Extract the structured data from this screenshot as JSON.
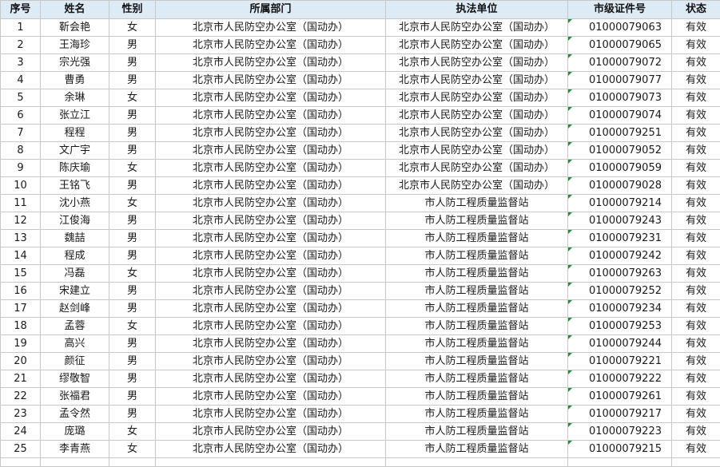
{
  "headers": [
    "序号",
    "姓名",
    "性别",
    "所属部门",
    "执法单位",
    "市级证件号",
    "状态"
  ],
  "rows": [
    [
      "1",
      "靳会艳",
      "女",
      "北京市人民防空办公室（国动办）",
      "北京市人民防空办公室（国动办）",
      "01000079063",
      "有效"
    ],
    [
      "2",
      "王海珍",
      "男",
      "北京市人民防空办公室（国动办）",
      "北京市人民防空办公室（国动办）",
      "01000079065",
      "有效"
    ],
    [
      "3",
      "宗光强",
      "男",
      "北京市人民防空办公室（国动办）",
      "北京市人民防空办公室（国动办）",
      "01000079072",
      "有效"
    ],
    [
      "4",
      "曹勇",
      "男",
      "北京市人民防空办公室（国动办）",
      "北京市人民防空办公室（国动办）",
      "01000079077",
      "有效"
    ],
    [
      "5",
      "余琳",
      "女",
      "北京市人民防空办公室（国动办）",
      "北京市人民防空办公室（国动办）",
      "01000079073",
      "有效"
    ],
    [
      "6",
      "张立江",
      "男",
      "北京市人民防空办公室（国动办）",
      "北京市人民防空办公室（国动办）",
      "01000079074",
      "有效"
    ],
    [
      "7",
      "程程",
      "男",
      "北京市人民防空办公室（国动办）",
      "北京市人民防空办公室（国动办）",
      "01000079251",
      "有效"
    ],
    [
      "8",
      "文广宇",
      "男",
      "北京市人民防空办公室（国动办）",
      "北京市人民防空办公室（国动办）",
      "01000079052",
      "有效"
    ],
    [
      "9",
      "陈庆瑜",
      "女",
      "北京市人民防空办公室（国动办）",
      "北京市人民防空办公室（国动办）",
      "01000079059",
      "有效"
    ],
    [
      "10",
      "王铭飞",
      "男",
      "北京市人民防空办公室（国动办）",
      "北京市人民防空办公室（国动办）",
      "01000079028",
      "有效"
    ],
    [
      "11",
      "沈小燕",
      "女",
      "北京市人民防空办公室（国动办）",
      "市人防工程质量监督站",
      "01000079214",
      "有效"
    ],
    [
      "12",
      "江俊海",
      "男",
      "北京市人民防空办公室（国动办）",
      "市人防工程质量监督站",
      "01000079243",
      "有效"
    ],
    [
      "13",
      "魏喆",
      "男",
      "北京市人民防空办公室（国动办）",
      "市人防工程质量监督站",
      "01000079231",
      "有效"
    ],
    [
      "14",
      "程成",
      "男",
      "北京市人民防空办公室（国动办）",
      "市人防工程质量监督站",
      "01000079242",
      "有效"
    ],
    [
      "15",
      "冯磊",
      "女",
      "北京市人民防空办公室（国动办）",
      "市人防工程质量监督站",
      "01000079263",
      "有效"
    ],
    [
      "16",
      "宋建立",
      "男",
      "北京市人民防空办公室（国动办）",
      "市人防工程质量监督站",
      "01000079252",
      "有效"
    ],
    [
      "17",
      "赵剑峰",
      "男",
      "北京市人民防空办公室（国动办）",
      "市人防工程质量监督站",
      "01000079234",
      "有效"
    ],
    [
      "18",
      "孟蓉",
      "女",
      "北京市人民防空办公室（国动办）",
      "市人防工程质量监督站",
      "01000079253",
      "有效"
    ],
    [
      "19",
      "高兴",
      "男",
      "北京市人民防空办公室（国动办）",
      "市人防工程质量监督站",
      "01000079244",
      "有效"
    ],
    [
      "20",
      "颜征",
      "男",
      "北京市人民防空办公室（国动办）",
      "市人防工程质量监督站",
      "01000079221",
      "有效"
    ],
    [
      "21",
      "缪敬智",
      "男",
      "北京市人民防空办公室（国动办）",
      "市人防工程质量监督站",
      "01000079222",
      "有效"
    ],
    [
      "22",
      "张福君",
      "男",
      "北京市人民防空办公室（国动办）",
      "市人防工程质量监督站",
      "01000079261",
      "有效"
    ],
    [
      "23",
      "孟令然",
      "男",
      "北京市人民防空办公室（国动办）",
      "市人防工程质量监督站",
      "01000079217",
      "有效"
    ],
    [
      "24",
      "庞璐",
      "女",
      "北京市人民防空办公室（国动办）",
      "市人防工程质量监督站",
      "01000079223",
      "有效"
    ],
    [
      "25",
      "李青燕",
      "女",
      "北京市人民防空办公室（国动办）",
      "市人防工程质量监督站",
      "01000079215",
      "有效"
    ]
  ],
  "colors": {
    "header_bg": "#ddebf7",
    "grid": "#c8c8c8",
    "cert_marker": "#1e8e3e"
  }
}
